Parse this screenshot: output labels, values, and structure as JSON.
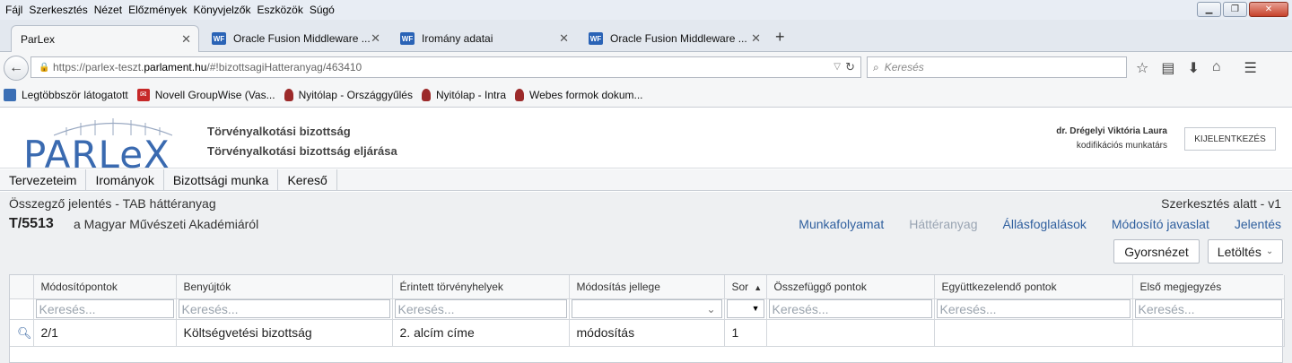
{
  "browser": {
    "menu": [
      "Fájl",
      "Szerkesztés",
      "Nézet",
      "Előzmények",
      "Könyvjelzők",
      "Eszközök",
      "Súgó"
    ],
    "window_controls": {
      "minimize": "▁",
      "maximize": "❐",
      "close": "✕"
    },
    "tabs": [
      {
        "label": "ParLex",
        "active": true
      },
      {
        "label": "Oracle Fusion Middleware ...",
        "active": false
      },
      {
        "label": "Iromány adatai",
        "active": false
      },
      {
        "label": "Oracle Fusion Middleware ...",
        "active": false
      }
    ],
    "new_tab_label": "+",
    "url_prefix": "https://parlex-teszt.",
    "url_host": "parlament.hu",
    "url_path": "/#!bizottsagiHatteranyag/463410",
    "search_placeholder": "Keresés",
    "bookmarks": [
      {
        "label": "Legtöbbször látogatott",
        "icon": "folder-icon"
      },
      {
        "label": "Novell GroupWise (Vas...",
        "icon": "mail-icon"
      },
      {
        "label": "Nyitólap - Országgyűlés",
        "icon": "crest-icon"
      },
      {
        "label": "Nyitólap - Intra",
        "icon": "crest-icon"
      },
      {
        "label": "Webes formok dokum...",
        "icon": "crest-icon"
      }
    ]
  },
  "app": {
    "logo_text": "PARLeX",
    "committee_line1": "Törvényalkotási bizottság",
    "committee_line2": "Törvényalkotási bizottság eljárása",
    "user_name": "dr. Drégelyi Viktória Laura",
    "user_role": "kodifikációs munkatárs",
    "logout_label": "KIJELENTKEZÉS",
    "nav": [
      "Tervezeteim",
      "Irományok",
      "Bizottsági munka",
      "Kereső"
    ],
    "doc_type": "Összegző jelentés - TAB háttéranyag",
    "doc_status": "Szerkesztés alatt - v1",
    "doc_id": "T/5513",
    "doc_title": "a Magyar Művészeti Akadémiáról",
    "doc_tabs": [
      {
        "label": "Munkafolyamat",
        "muted": false
      },
      {
        "label": "Háttéranyag",
        "muted": true
      },
      {
        "label": "Állásfoglalások",
        "muted": false
      },
      {
        "label": "Módosító javaslat",
        "muted": false
      },
      {
        "label": "Jelentés",
        "muted": false
      }
    ],
    "btn_quickview": "Gyorsnézet",
    "btn_download": "Letöltés",
    "grid": {
      "columns": [
        "Módosítópontok",
        "Benyújtók",
        "Érintett törvényhelyek",
        "Módosítás jellege",
        "Sor",
        "Összefüggő pontok",
        "Együttkezelendő pontok",
        "Első megjegyzés"
      ],
      "filter_placeholder": "Keresés...",
      "rows": [
        {
          "cells": [
            "2/1",
            "Költségvetési bizottság",
            "2. alcím címe",
            "módosítás",
            "1",
            "",
            "",
            ""
          ]
        }
      ]
    }
  }
}
